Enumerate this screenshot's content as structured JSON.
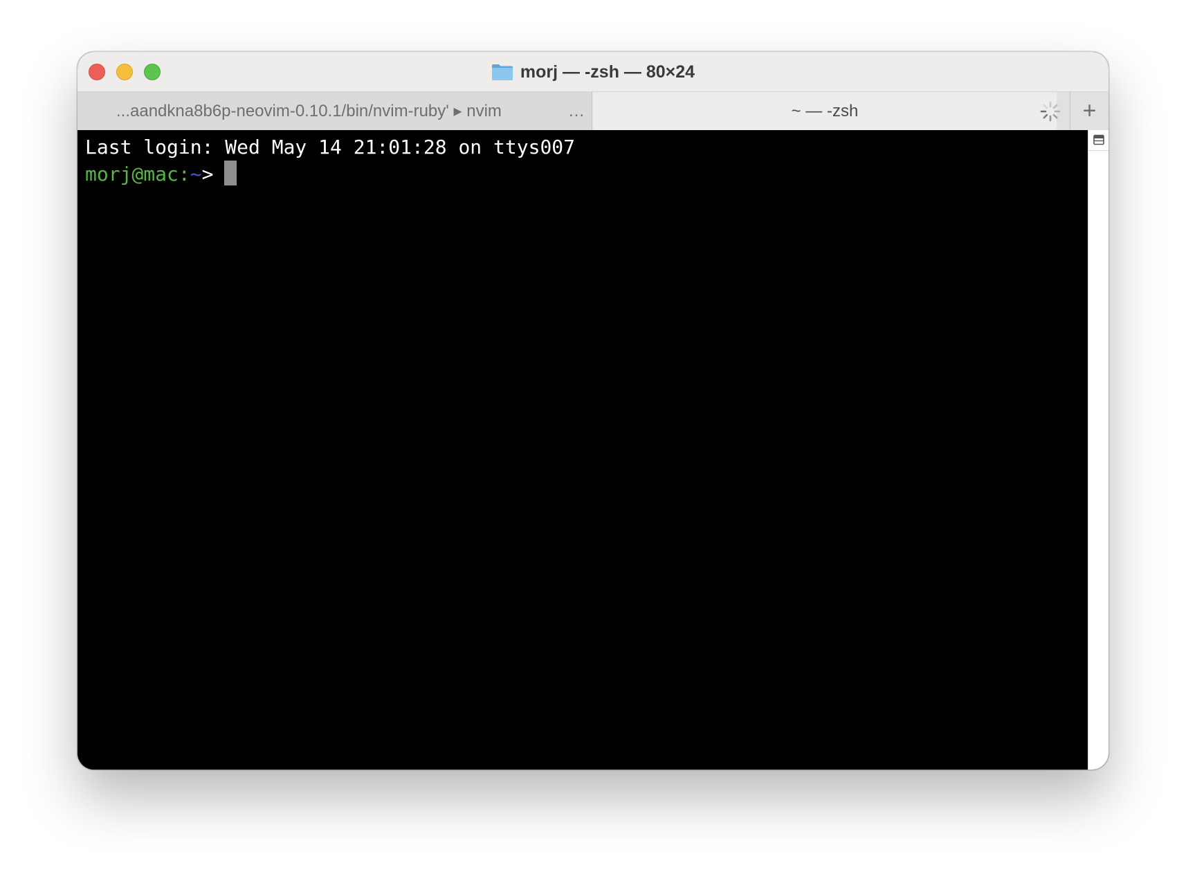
{
  "window": {
    "title": "morj — -zsh — 80×24",
    "title_icon": "folder-icon"
  },
  "tabs": [
    {
      "label": "...aandkna8b6p-neovim-0.10.1/bin/nvim-ruby' ▸ nvim",
      "overflow": "...",
      "active": false
    },
    {
      "label": "~ — -zsh",
      "active": true,
      "status_icon": "spinner-icon"
    }
  ],
  "new_tab_label": "+",
  "terminal": {
    "last_login": "Last login: Wed May 14 21:01:28 on ttys007",
    "prompt_user_host": "morj@mac:",
    "prompt_dir": "~",
    "prompt_symbol": ">"
  },
  "colors": {
    "prompt_user": "#5bb34a",
    "prompt_dir": "#4a4fd6",
    "cursor": "#8f8f8f",
    "background": "#000000"
  }
}
